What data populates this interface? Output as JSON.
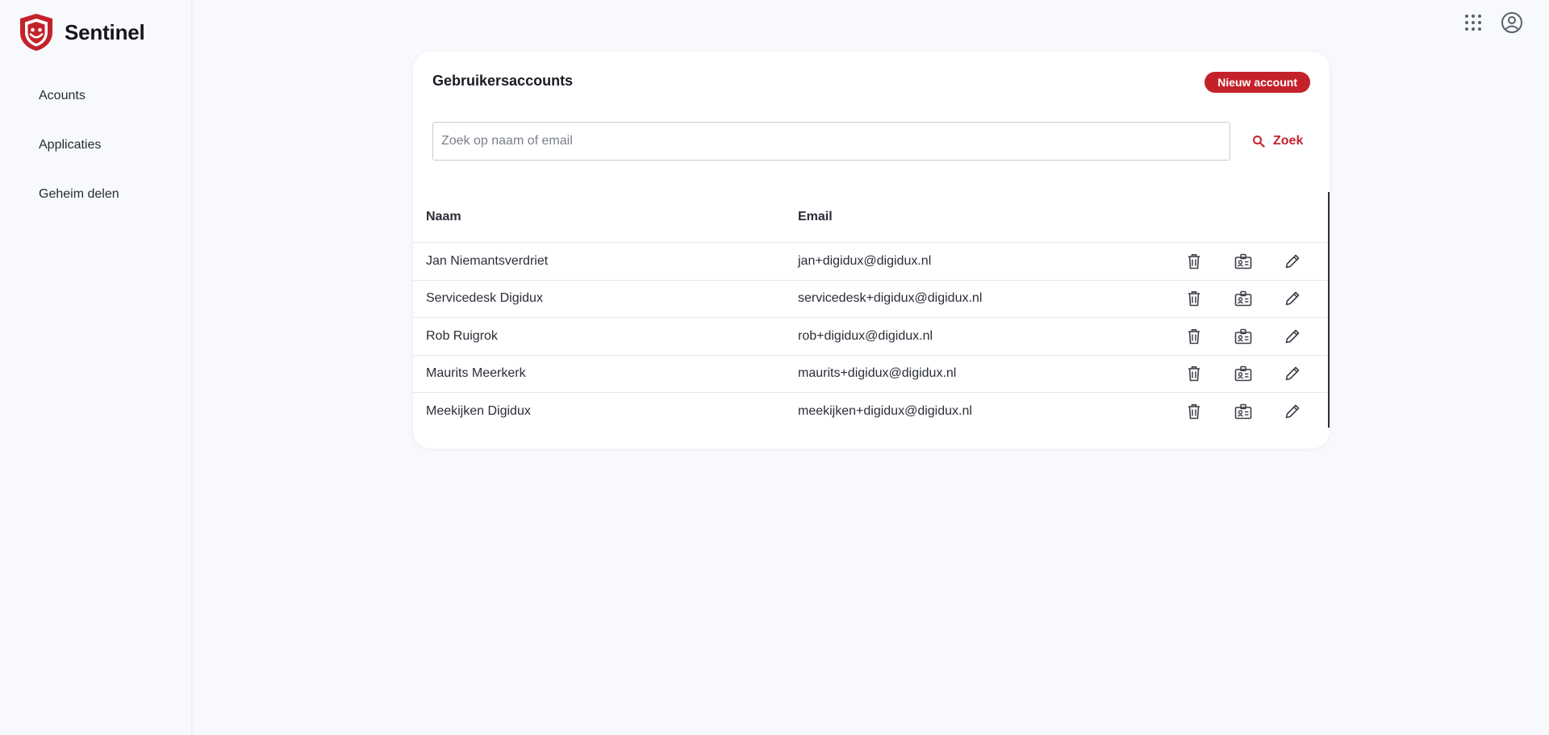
{
  "app": {
    "name": "Sentinel",
    "brand_color": "#c4222b"
  },
  "sidebar": {
    "items": [
      {
        "label": "Acounts"
      },
      {
        "label": "Applicaties"
      },
      {
        "label": "Geheim delen"
      }
    ]
  },
  "topbar": {
    "icons": [
      "apps-grid-icon",
      "account-circle-icon"
    ]
  },
  "card": {
    "title": "Gebruikersaccounts",
    "new_button_label": "Nieuw account",
    "search": {
      "placeholder": "Zoek op naam of email",
      "value": "",
      "button_label": "Zoek"
    },
    "table": {
      "columns": [
        "Naam",
        "Email"
      ],
      "rows": [
        {
          "name": "Jan Niemantsverdriet",
          "email": "jan+digidux@digidux.nl"
        },
        {
          "name": "Servicedesk Digidux",
          "email": "servicedesk+digidux@digidux.nl"
        },
        {
          "name": "Rob Ruigrok",
          "email": "rob+digidux@digidux.nl"
        },
        {
          "name": "Maurits Meerkerk",
          "email": "maurits+digidux@digidux.nl"
        },
        {
          "name": "Meekijken Digidux",
          "email": "meekijken+digidux@digidux.nl"
        }
      ],
      "row_actions": [
        "trash-icon",
        "id-badge-icon",
        "pencil-icon"
      ]
    }
  }
}
